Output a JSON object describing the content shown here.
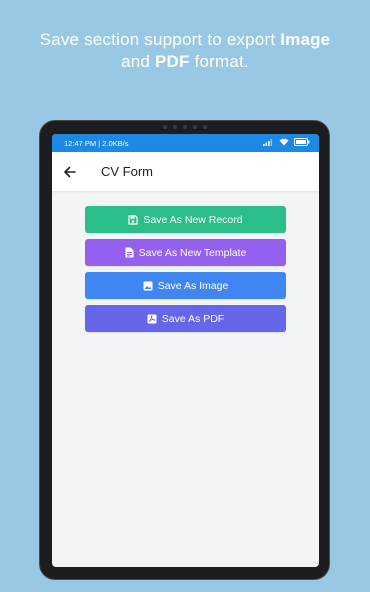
{
  "headline": {
    "line1_prefix": "Save section support to export ",
    "line1_bold": "Image",
    "line2_prefix": "and ",
    "line2_bold": "PDF",
    "line2_suffix": " format."
  },
  "statusbar": {
    "text": "12:47 PM | 2.0KB/s",
    "icons": [
      "signal-icon",
      "wifi-icon",
      "battery-icon"
    ]
  },
  "appbar": {
    "title": "CV Form",
    "back_icon": "back-arrow-icon"
  },
  "actions": [
    {
      "label": "Save As New Record",
      "icon": "save-icon",
      "color": "#2bbd8a"
    },
    {
      "label": "Save As New Template",
      "icon": "document-icon",
      "color": "#9460f0"
    },
    {
      "label": "Save As Image",
      "icon": "image-icon",
      "color": "#3f86f2"
    },
    {
      "label": "Save As PDF",
      "icon": "pdf-icon",
      "color": "#6566ea"
    }
  ],
  "colors": {
    "background": "#98c8e4",
    "statusbar": "#1e88e5"
  }
}
